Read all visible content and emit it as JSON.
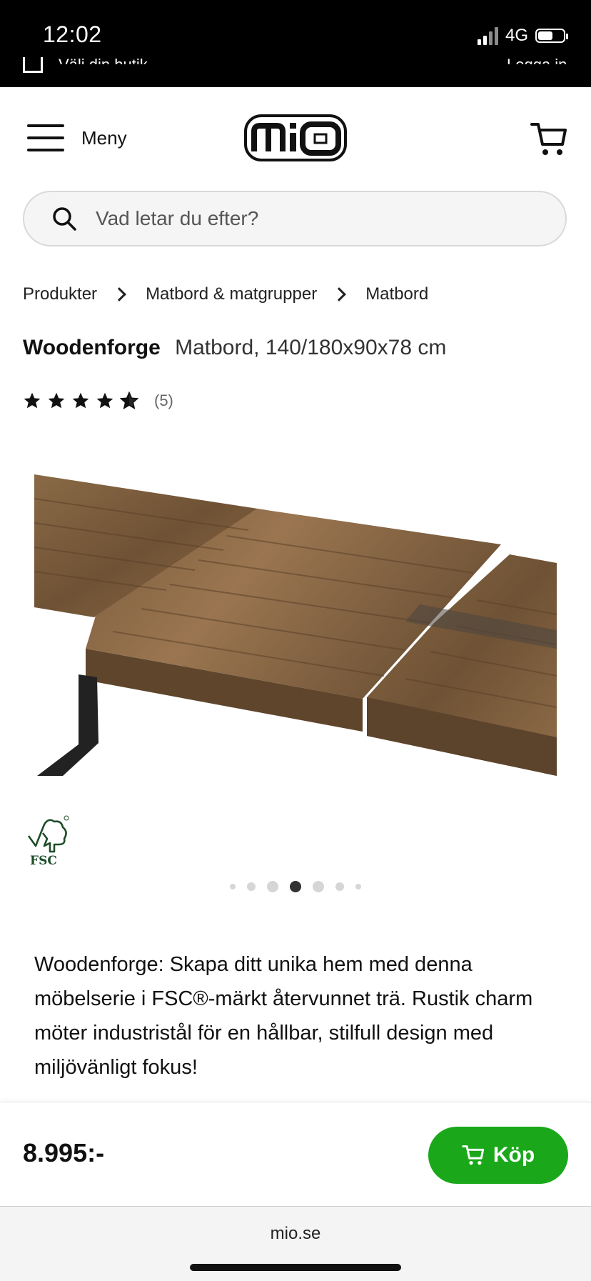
{
  "status_bar": {
    "time": "12:02",
    "network": "4G",
    "peek_left": "Välj din butik",
    "peek_right": "Logga in"
  },
  "header": {
    "menu_label": "Meny",
    "logo_text": "mio"
  },
  "search": {
    "placeholder": "Vad letar du efter?"
  },
  "breadcrumb": [
    "Produkter",
    "Matbord & matgrupper",
    "Matbord"
  ],
  "product": {
    "brand": "Woodenforge",
    "subtitle": "Matbord, 140/180x90x78 cm",
    "rating_count": "(5)",
    "rating_value": 4.5,
    "certification_label": "FSC",
    "gallery": {
      "total_images": 7,
      "active_index": 3
    },
    "description": "Woodenforge: Skapa ditt unika hem med denna möbelserie i FSC®-märkt återvunnet trä. Rustik charm möter industristål för en hållbar, stilfull design med miljövänligt fokus!"
  },
  "buy_bar": {
    "price": "8.995:-",
    "buy_label": "Köp"
  },
  "browser": {
    "url": "mio.se"
  },
  "colors": {
    "buy_green": "#1aa81a",
    "wood": "#7a5a3a",
    "text": "#111111"
  },
  "icons": [
    "menu-icon",
    "cart-icon",
    "search-icon",
    "star-icon",
    "half-star-icon",
    "fsc-logo",
    "cart-icon-small"
  ]
}
